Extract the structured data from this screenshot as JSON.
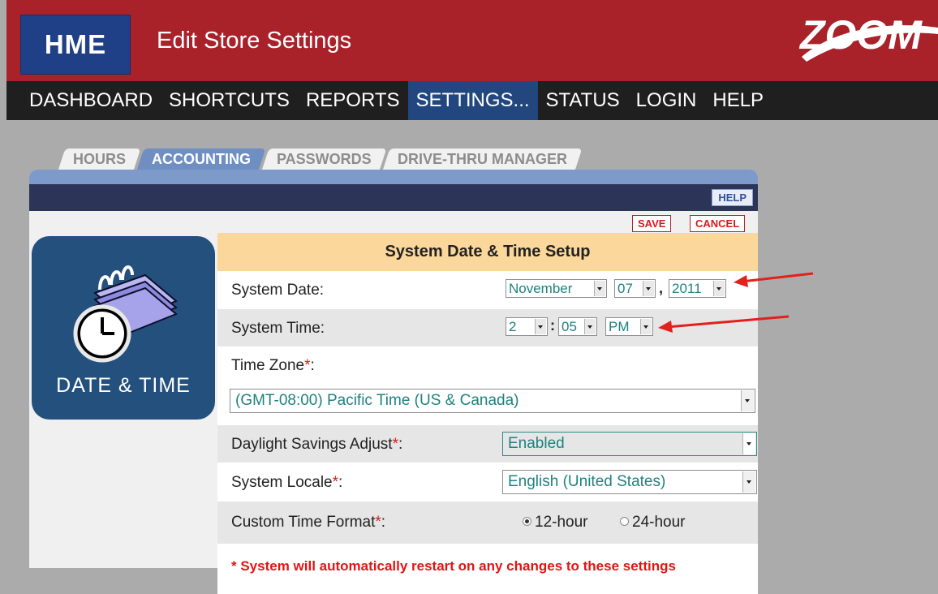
{
  "header": {
    "logo": "HME",
    "title": "Edit Store Settings",
    "brand": "ZOOM"
  },
  "nav": {
    "items": [
      "DASHBOARD",
      "SHORTCUTS",
      "REPORTS",
      "SETTINGS...",
      "STATUS",
      "LOGIN",
      "HELP"
    ],
    "active": "SETTINGS..."
  },
  "tabs": {
    "items": [
      "HOURS",
      "ACCOUNTING",
      "PASSWORDS",
      "DRIVE-THRU MANAGER"
    ],
    "active": "ACCOUNTING"
  },
  "panel": {
    "help_label": "HELP",
    "save_label": "SAVE",
    "cancel_label": "CANCEL"
  },
  "side": {
    "label": "DATE & TIME",
    "icon": "calendar-clock-icon"
  },
  "form": {
    "title": "System Date & Time Setup",
    "date_label": "System Date:",
    "date_month": "November",
    "date_day": "07",
    "date_sep": ",",
    "date_year": "2011",
    "time_label": "System Time:",
    "time_hour": "2",
    "time_sep": ":",
    "time_minute": "05",
    "time_ampm": "PM",
    "tz_label": "Time Zone",
    "tz_value": "(GMT-08:00) Pacific Time (US & Canada)",
    "dst_label": "Daylight Savings Adjust",
    "dst_value": "Enabled",
    "locale_label": "System Locale",
    "locale_value": "English (United States)",
    "format_label": "Custom Time Format",
    "format_12": "12-hour",
    "format_24": "24-hour",
    "required_mark": "*",
    "label_colon": ":",
    "warning": "* System will automatically restart on any changes to these settings"
  },
  "colors": {
    "header_red": "#a9222a",
    "logo_blue": "#1f3f86",
    "nav_active": "#22477f",
    "form_title_bg": "#fbd79b",
    "value_teal": "#1e827f",
    "warning_red": "#e01515",
    "annotation_arrow": "#e3201b"
  }
}
